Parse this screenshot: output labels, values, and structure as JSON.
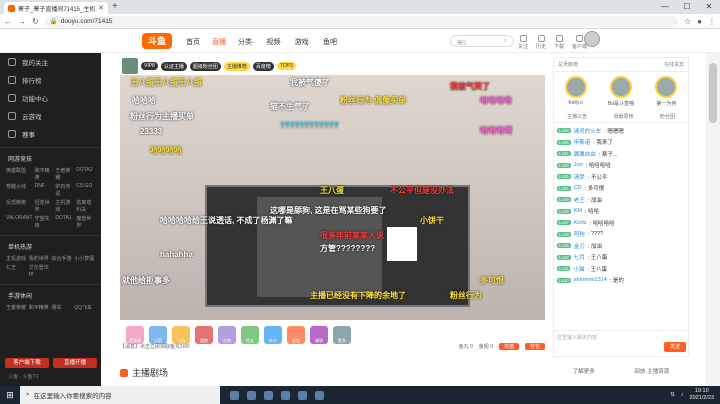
{
  "browser": {
    "tab_title": "寒子_寒子直播间71415_主机游...",
    "url": "douyu.com/71415",
    "new_tab": "+",
    "win": [
      "—",
      "☐",
      "✕"
    ]
  },
  "header": {
    "logo": "斗鱼",
    "nav": [
      "首页",
      "直播",
      "分类·",
      "视频·",
      "游戏·",
      "鱼吧"
    ],
    "search_placeholder": "寒5",
    "icons": [
      "关注",
      "历史",
      "下载",
      "客户端"
    ]
  },
  "sidebar": {
    "items": [
      "我的关注",
      "排行榜",
      "功能中心",
      "云游戏",
      "赛事"
    ],
    "sec1": "网游竞技",
    "grid1": [
      "英雄联盟",
      "和平精英",
      "王者荣耀",
      "DOTA2",
      "穿越火线",
      "DNF",
      "炉石传说",
      "CS:GO",
      "反恐精英",
      "坦克世界",
      "主机游戏",
      "逃离塔科夫",
      "VALORANT",
      "守望先锋",
      "DOTA1",
      "魔兽世界"
    ],
    "sec2": "单机热游",
    "grid2": [
      "主机游戏",
      "我的世界",
      "综合手游",
      "小小梦魇",
      "仁王",
      "艾尔登法环"
    ],
    "sec3": "手游休闲",
    "grid3": [
      "王者荣耀",
      "和平精英",
      "赛车",
      "QQ飞车"
    ],
    "buttons": [
      "客户端下载",
      "直播开播"
    ],
    "footer": "斗鱼 · 斗鱼TV"
  },
  "player": {
    "top_tags": [
      "VIP8",
      "认证主播",
      "超级粉丝团",
      "主播推荐",
      "百度榜",
      "TOP3"
    ],
    "danmaku": [
      {
        "t": "王八蛋王八蛋王八蛋",
        "c": "#ffe23d"
      },
      {
        "t": "我被气傻了",
        "c": "#ffffff"
      },
      {
        "t": "我被气哭了",
        "c": "#ff3c3c"
      },
      {
        "t": "哈哈哈",
        "c": "#ffffff"
      },
      {
        "t": "粉丝行为主播买单",
        "c": "#ffffff"
      },
      {
        "t": "23333",
        "c": "#ffffff"
      },
      {
        "t": "粉丝行为 偶像买单",
        "c": "#ffe23d"
      },
      {
        "t": "哈哈哈哈",
        "c": "#ff6fd4"
      },
      {
        "t": "哈哈哈啊",
        "c": "#ff6fd4"
      },
      {
        "t": "这哪是舔狗, 这是在骂某些狗要了",
        "c": "#ffffff"
      },
      {
        "t": "????????????",
        "c": "#3ae0ff"
      },
      {
        "t": "王八蛋",
        "c": "#ffe23d"
      },
      {
        "t": "不公平但是没办法",
        "c": "#ff3c3c"
      },
      {
        "t": "哈哈哈哈给王说透话, 不成了杨渊了嘛",
        "c": "#ffffff"
      },
      {
        "t": "很多年前某某人说",
        "c": "#ff3c3c"
      },
      {
        "t": "方管????????",
        "c": "#ffffff"
      },
      {
        "t": "就他给拒事多",
        "c": "#ffffff"
      },
      {
        "t": "主播已经没有下降的余地了",
        "c": "#ffe23d"
      },
      {
        "t": "粉丝行为",
        "c": "#ffe23d"
      },
      {
        "t": "多可恨",
        "c": "#ffe23d"
      },
      {
        "t": "哈哈哈哈",
        "c": "#ffe23d"
      },
      {
        "t": "hahahha",
        "c": "#ffffff"
      },
      {
        "t": "小饼干",
        "c": "#ffe23d"
      },
      {
        "t": "猫不生气了",
        "c": "#ffffff"
      }
    ],
    "gifts": [
      "荧光棒",
      "火箭",
      "飞机",
      "超跑",
      "礼物",
      "鱼丸",
      "办卡",
      "鲨鱼",
      "福袋",
      "更多"
    ],
    "footer_left": "【消息】点击立即领取鱼丸100!",
    "footer_right": [
      "鱼丸 0",
      "鱼翅 0",
      "充值",
      "背包"
    ]
  },
  "section_title": "主播剧场",
  "right_panel": {
    "top": [
      "总贡献榜",
      "在线贵宾"
    ],
    "rank": [
      "Kelly.o",
      "Bo是斗皇喵",
      "第一为何"
    ],
    "tabs": [
      "主播公告",
      "贡献周榜",
      "粉丝团"
    ],
    "chat": [
      {
        "b": "Lv38",
        "u": "清灵的火车",
        "m": ": 嗯嗯嗯"
      },
      {
        "b": "Lv36",
        "u": "甲斯诺",
        "m": ": 我来了"
      },
      {
        "b": "Lv31",
        "u": "翼鹰自由",
        "m": ": 寒子..."
      },
      {
        "b": "Lv23",
        "u": "Jun",
        "m": ": 哈哈哈哈"
      },
      {
        "b": "Lv25",
        "u": "清梦",
        "m": ": 不公平"
      },
      {
        "b": "Lv21",
        "u": "CD",
        "m": ": 多可恨"
      },
      {
        "b": "Lv19",
        "u": "老王",
        "m": ": 加油"
      },
      {
        "b": "Lv18",
        "u": "KM",
        "m": ": 哈哈"
      },
      {
        "b": "Lv17",
        "u": "Kortz",
        "m": ": 哈哈哈哈"
      },
      {
        "b": "Lv16",
        "u": "阿狗",
        "m": ": ????"
      },
      {
        "b": "Lv15",
        "u": "金刀",
        "m": ": 加油"
      },
      {
        "b": "Lv12",
        "u": "七月",
        "m": ": 王八蛋"
      },
      {
        "b": "Lv11",
        "u": "小猫",
        "m": ": 王八蛋"
      },
      {
        "b": "Lv10",
        "u": "shiroemi1314",
        "m": ": 是的"
      }
    ],
    "input_placeholder": "这里输入聊天内容",
    "send": "发送",
    "footer": [
      "了解更多",
      "回放·主播资源"
    ]
  },
  "taskbar": {
    "search": "在这里输入你要搜索的内容",
    "time": "19:10",
    "date": "2021/2/23"
  }
}
